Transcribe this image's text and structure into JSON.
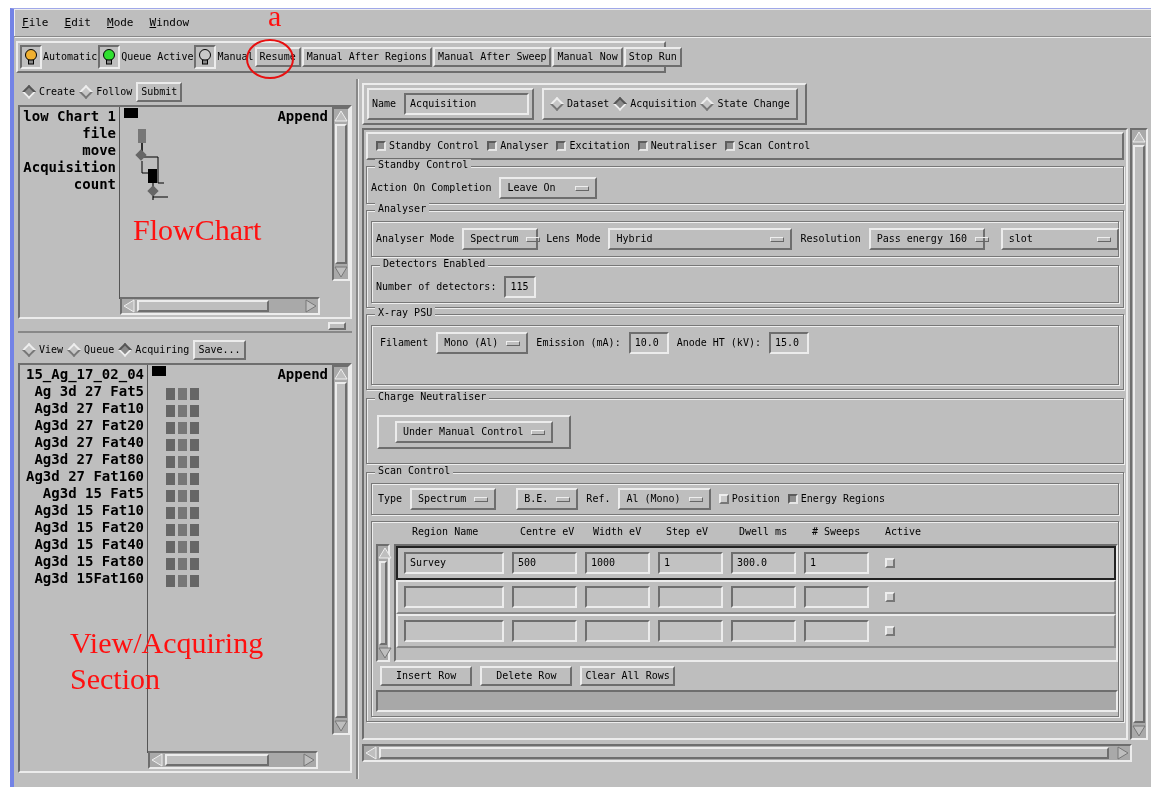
{
  "menu": [
    "File",
    "Edit",
    "Mode",
    "Window"
  ],
  "toolbar": {
    "indicators": [
      {
        "label": "Automatic",
        "color": "#f0b030"
      },
      {
        "label": "Queue Active",
        "color": "#30e030"
      },
      {
        "label": "Manual",
        "color": "#c8c8c8"
      }
    ],
    "buttons": [
      "Resume",
      "Manual After Regions",
      "Manual After Sweep",
      "Manual Now",
      "Stop Run"
    ]
  },
  "annotations": {
    "marker": "a",
    "flowchart": "FlowChart",
    "view_section": "View/Acquiring Section"
  },
  "flowchart": {
    "modes": [
      {
        "label": "Create",
        "selected": true
      },
      {
        "label": "Follow",
        "selected": false
      }
    ],
    "submit": "Submit",
    "labels": [
      "low Chart 1",
      "file",
      "move",
      "Acquisition",
      "count"
    ],
    "append": "Append"
  },
  "view": {
    "modes": [
      {
        "label": "View",
        "selected": false
      },
      {
        "label": "Queue",
        "selected": false
      },
      {
        "label": "Acquiring",
        "selected": true
      }
    ],
    "save": "Save...",
    "items": [
      "15_Ag_17_02_04",
      "Ag 3d 27 Fat5",
      "Ag3d 27 Fat10",
      "Ag3d 27 Fat20",
      "Ag3d 27 Fat40",
      "Ag3d 27 Fat80",
      "Ag3d 27 Fat160",
      "Ag3d 15 Fat5",
      "Ag3d 15 Fat10",
      "Ag3d 15 Fat20",
      "Ag3d 15 Fat40",
      "Ag3d 15 Fat80",
      "Ag3d 15Fat160"
    ],
    "append": "Append"
  },
  "editor": {
    "name_label": "Name",
    "name_value": "Acquisition",
    "types": [
      {
        "label": "Dataset",
        "selected": false
      },
      {
        "label": "Acquisition",
        "selected": true
      },
      {
        "label": "State Change",
        "selected": false
      }
    ],
    "sections": [
      {
        "label": "Standby Control",
        "checked": true
      },
      {
        "label": "Analyser",
        "checked": true
      },
      {
        "label": "Excitation",
        "checked": true
      },
      {
        "label": "Neutraliser",
        "checked": true
      },
      {
        "label": "Scan Control",
        "checked": true
      }
    ],
    "standby": {
      "title": "Standby Control",
      "label": "Action On Completion",
      "value": "Leave On"
    },
    "analyser": {
      "title": "Analyser",
      "mode_label": "Analyser Mode",
      "mode": "Spectrum",
      "lens_label": "Lens Mode",
      "lens": "Hybrid",
      "resolution_label": "Resolution",
      "resolution": "Pass energy 160",
      "slit": "slot",
      "detectors": {
        "title": "Detectors Enabled",
        "label": "Number of detectors:",
        "value": "115"
      }
    },
    "xray": {
      "title": "X-ray PSU",
      "filament_label": "Filament",
      "filament": "Mono (Al)",
      "emission_label": "Emission (mA):",
      "emission": "10.0",
      "anode_label": "Anode HT (kV):",
      "anode": "15.0"
    },
    "neutraliser": {
      "title": "Charge Neutraliser",
      "value": "Under Manual Control"
    },
    "scan": {
      "title": "Scan Control",
      "type_label": "Type",
      "type": "Spectrum",
      "scale": "B.E.",
      "ref_label": "Ref.",
      "ref": "Al (Mono)",
      "options": [
        {
          "label": "Position",
          "checked": false
        },
        {
          "label": "Energy Regions",
          "checked": true
        }
      ],
      "columns": [
        "Region Name",
        "Centre eV",
        "Width eV",
        "Step eV",
        "Dwell ms",
        "# Sweeps",
        "Active"
      ],
      "rows": [
        {
          "cells": [
            "Survey",
            "500",
            "1000",
            "1",
            "300.0",
            "1"
          ],
          "active": false,
          "selected": true
        },
        {
          "active": false,
          "selected": false
        },
        {
          "active": false,
          "selected": false
        }
      ],
      "buttons": [
        "Insert Row",
        "Delete Row",
        "Clear All Rows"
      ]
    }
  }
}
